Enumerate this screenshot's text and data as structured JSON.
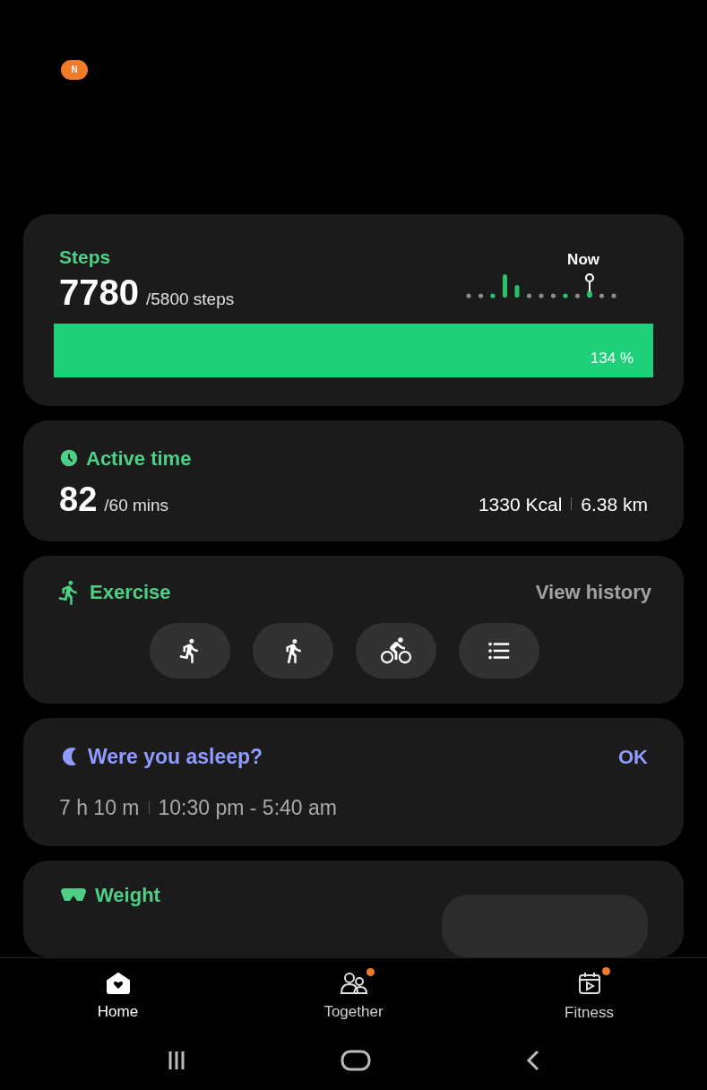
{
  "notification_badge": "N",
  "steps": {
    "title": "Steps",
    "value": "7780",
    "goal": "/5800 steps",
    "now_label": "Now",
    "level": 1,
    "percent": "134 %"
  },
  "active_time": {
    "title": "Active time",
    "value": "82",
    "goal": "/60 mins",
    "calories": "1330 Kcal",
    "distance": "6.38 km"
  },
  "exercise": {
    "title": "Exercise",
    "link": "View history",
    "buttons": [
      {
        "kind": "run"
      },
      {
        "kind": "walk"
      },
      {
        "kind": "bike"
      },
      {
        "kind": "list"
      }
    ]
  },
  "sleep": {
    "title": "Were you asleep?",
    "action": "OK",
    "duration": "7 h 10 m",
    "range": "10:30 pm - 5:40 am"
  },
  "weight": {
    "title": "Weight"
  },
  "tabs": [
    {
      "label": "Home",
      "kind": "home",
      "selected": true,
      "badge": false
    },
    {
      "label": "Together",
      "kind": "together",
      "selected": false,
      "badge": true
    },
    {
      "label": "Fitness",
      "kind": "fitness",
      "selected": false,
      "badge": true
    }
  ]
}
